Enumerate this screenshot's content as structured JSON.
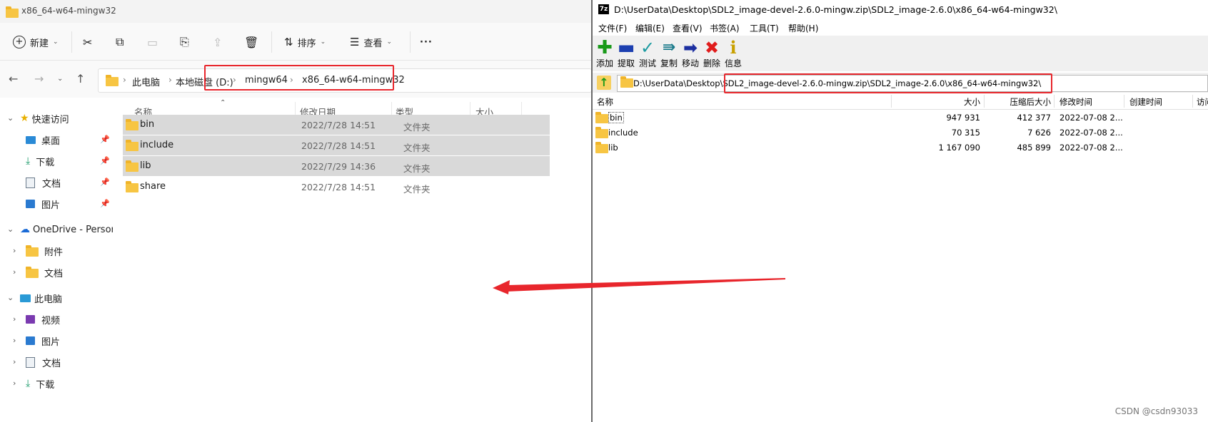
{
  "explorer": {
    "window_title": "x86_64-w64-mingw32",
    "toolbar": {
      "new_label": "新建",
      "sort_label": "排序",
      "view_label": "查看",
      "more_label": "···"
    },
    "breadcrumb": [
      "此电脑",
      "本地磁盘 (D:)",
      "mingw64",
      "x86_64-w64-mingw32"
    ],
    "nav": {
      "quick_access": "快速访问",
      "quick_items": [
        "桌面",
        "下载",
        "文档",
        "图片"
      ],
      "onedrive": "OneDrive - Persor",
      "onedrive_items": [
        "附件",
        "文档"
      ],
      "this_pc": "此电脑",
      "pc_items": [
        "视频",
        "图片",
        "文档",
        "下载"
      ]
    },
    "columns": {
      "name": "名称",
      "modified": "修改日期",
      "type": "类型",
      "size": "大小"
    },
    "rows": [
      {
        "name": "bin",
        "modified": "2022/7/28 14:51",
        "type": "文件夹",
        "selected": true
      },
      {
        "name": "include",
        "modified": "2022/7/28 14:51",
        "type": "文件夹",
        "selected": true
      },
      {
        "name": "lib",
        "modified": "2022/7/29 14:36",
        "type": "文件夹",
        "selected": true
      },
      {
        "name": "share",
        "modified": "2022/7/28 14:51",
        "type": "文件夹",
        "selected": false
      }
    ]
  },
  "sevenzip": {
    "window_title": "D:\\UserData\\Desktop\\SDL2_image-devel-2.6.0-mingw.zip\\SDL2_image-2.6.0\\x86_64-w64-mingw32\\",
    "menus": [
      "文件(F)",
      "编辑(E)",
      "查看(V)",
      "书签(A)",
      "工具(T)",
      "帮助(H)"
    ],
    "tools": [
      {
        "label": "添加",
        "icon": "plus-icon",
        "color": "#1a9a1a"
      },
      {
        "label": "提取",
        "icon": "minus-icon",
        "color": "#1c3fb0"
      },
      {
        "label": "测试",
        "icon": "check-icon",
        "color": "#1a9aa0"
      },
      {
        "label": "复制",
        "icon": "double-arrow-icon",
        "color": "#1a7a8a"
      },
      {
        "label": "移动",
        "icon": "arrow-right-icon",
        "color": "#1c2fa0"
      },
      {
        "label": "删除",
        "icon": "x-icon",
        "color": "#e01c1c"
      },
      {
        "label": "信息",
        "icon": "info-icon",
        "color": "#c8a000"
      }
    ],
    "address": "D:\\UserData\\Desktop\\SDL2_image-devel-2.6.0-mingw.zip\\SDL2_image-2.6.0\\x86_64-w64-mingw32\\",
    "columns": {
      "name": "名称",
      "size": "大小",
      "packed": "压缩后大小",
      "modified": "修改时间",
      "created": "创建时间",
      "accessed": "访问时间"
    },
    "rows": [
      {
        "name": "bin",
        "size": "947 931",
        "packed": "412 377",
        "modified": "2022-07-08 2..."
      },
      {
        "name": "include",
        "size": "70 315",
        "packed": "7 626",
        "modified": "2022-07-08 2..."
      },
      {
        "name": "lib",
        "size": "1 167 090",
        "packed": "485 899",
        "modified": "2022-07-08 2..."
      }
    ]
  },
  "watermark": "CSDN @csdn93033",
  "colors": {
    "highlight": "#e8262c",
    "arrow": "#e8262c",
    "folder": "#f7c543"
  }
}
